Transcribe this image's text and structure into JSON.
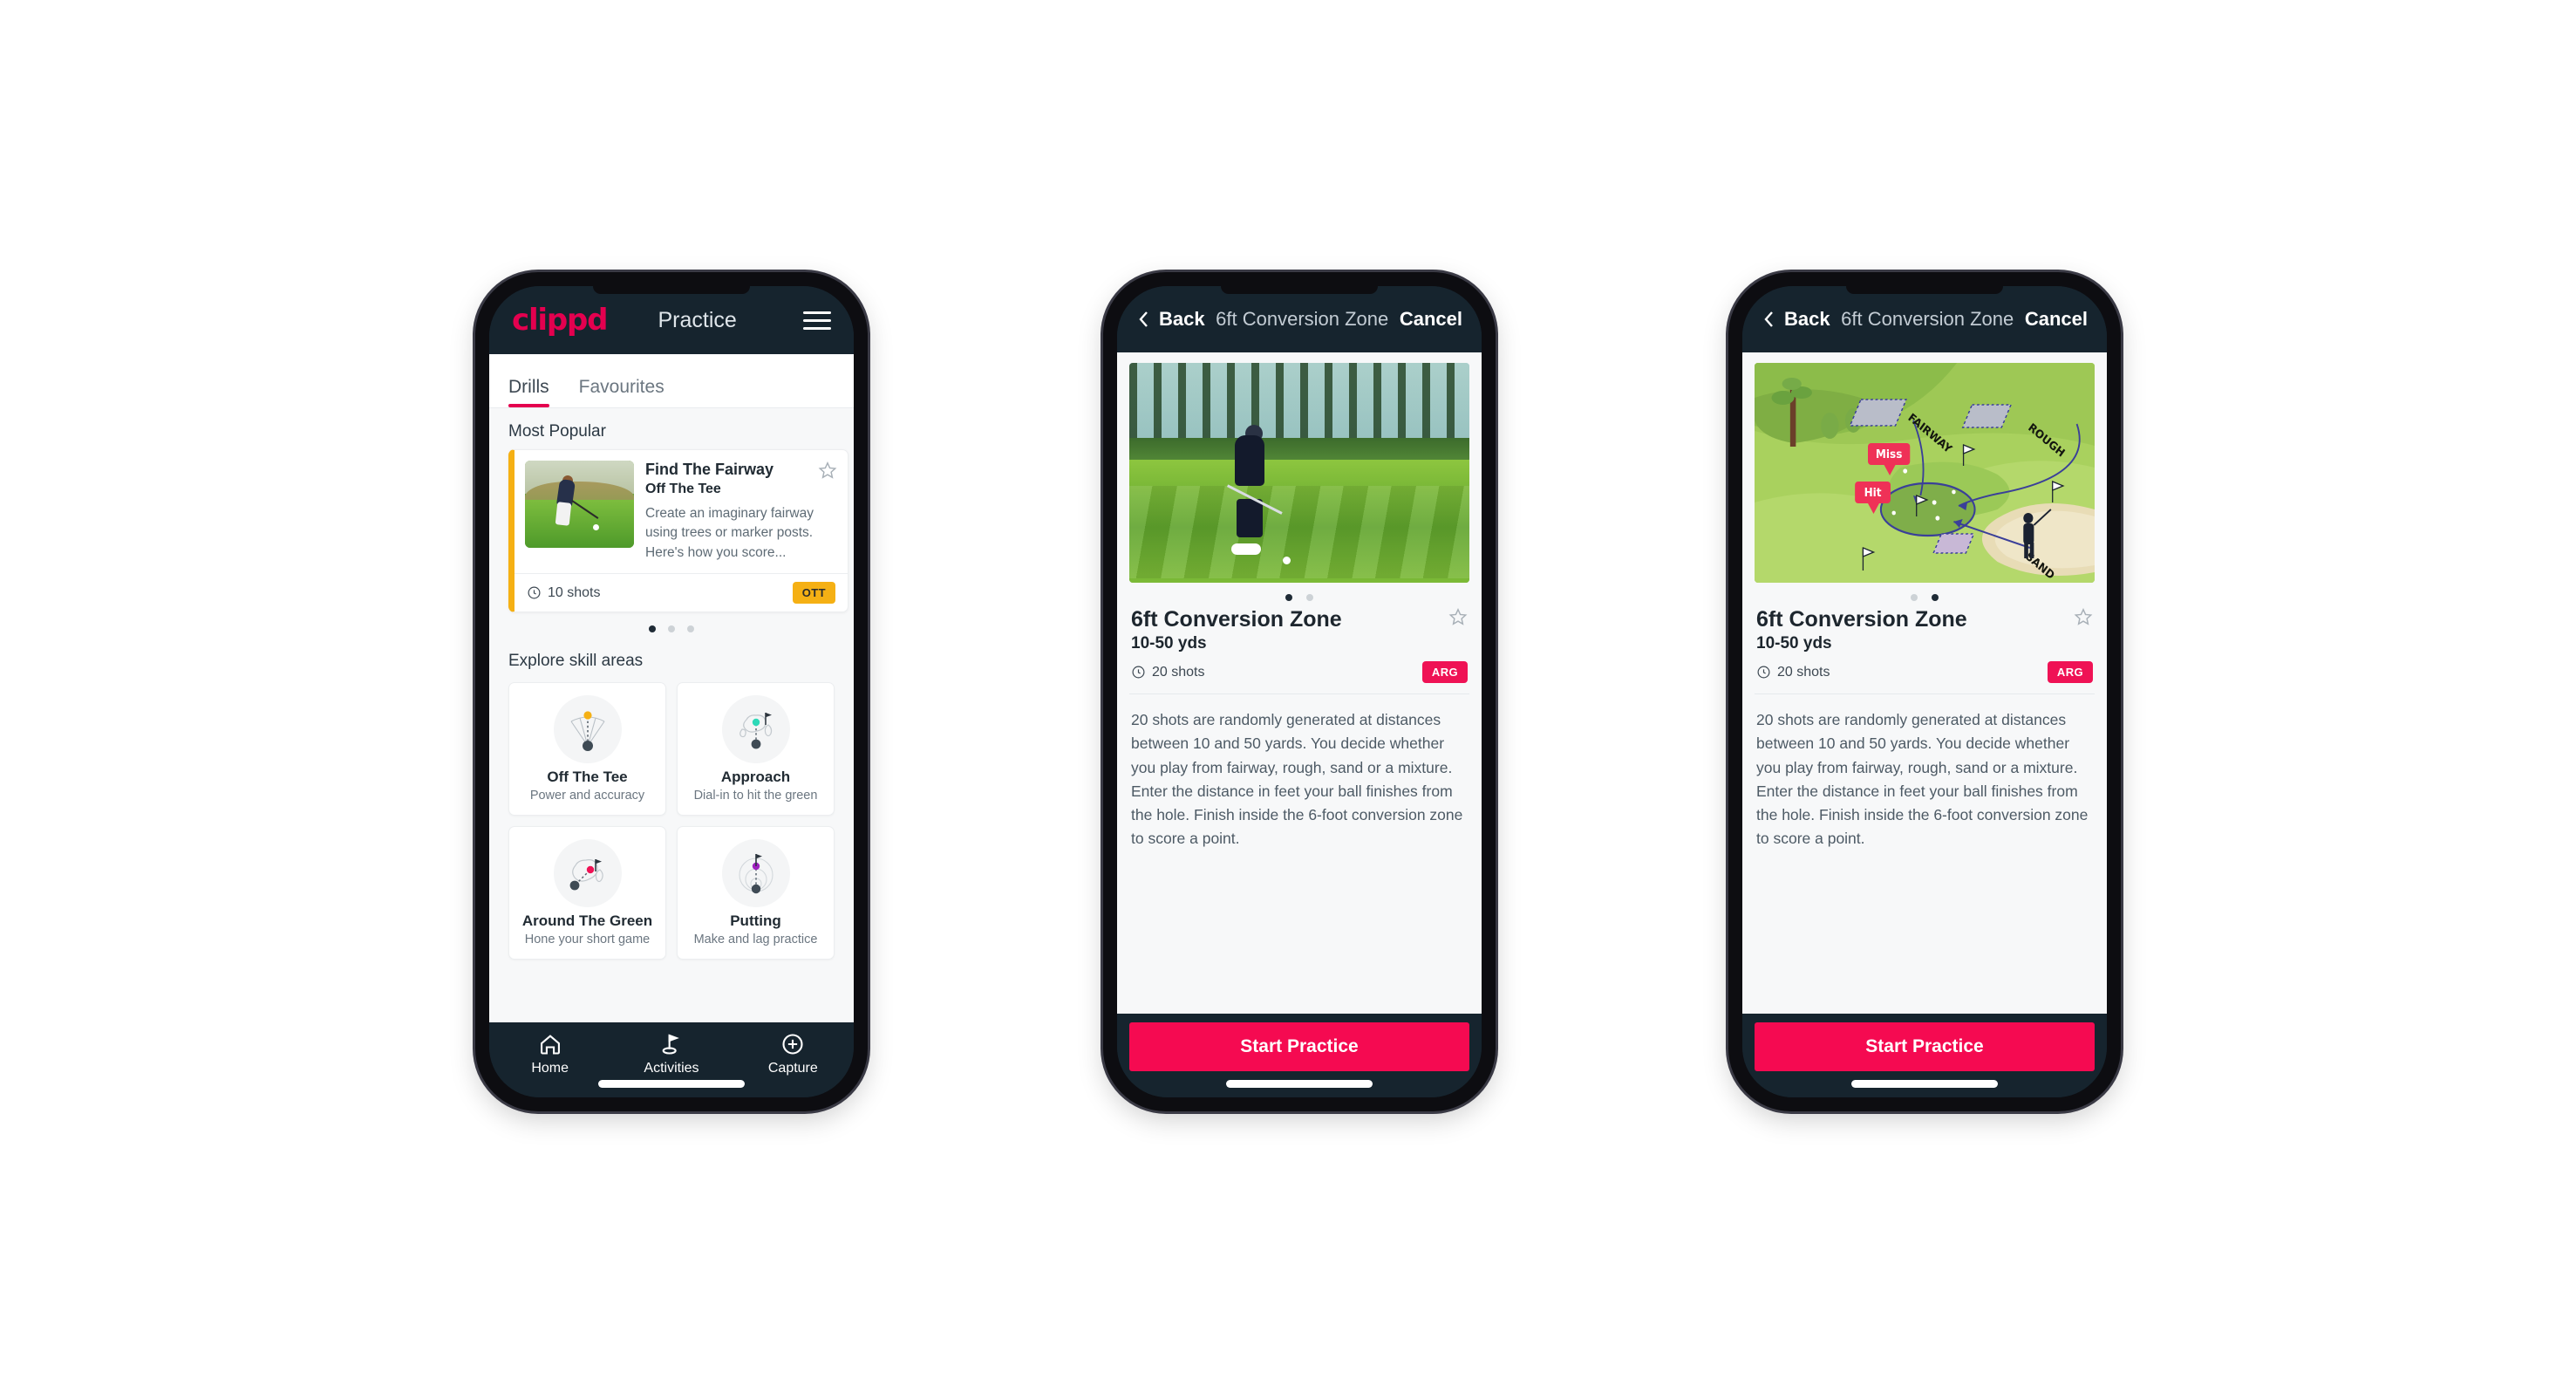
{
  "colors": {
    "brand_pink": "#e4004f",
    "cta_pink": "#f50a51",
    "badge_ott_yellow": "#f5b014",
    "badge_arg_pink": "#ef1255",
    "header_navy": "#16242e",
    "accent_teal": "#2ed9b8"
  },
  "phone1": {
    "header": {
      "logo": "clippd",
      "title": "Practice",
      "menu_icon": "hamburger-menu-icon"
    },
    "tabs": [
      {
        "label": "Drills",
        "active": true
      },
      {
        "label": "Favourites",
        "active": false
      }
    ],
    "most_popular": {
      "section_title": "Most Popular",
      "card": {
        "name": "Find The Fairway",
        "skill": "Off The Tee",
        "description": "Create an imaginary fairway using trees or marker posts. Here's how you score...",
        "shots": "10 shots",
        "badge": "OTT",
        "favourite_icon": "star-outline-icon",
        "shots_icon": "clock-icon",
        "accent_color": "#f5b014"
      },
      "dots": [
        true,
        false,
        false
      ]
    },
    "skill_areas": {
      "section_title": "Explore skill areas",
      "items": [
        {
          "name": "Off The Tee",
          "desc": "Power and accuracy",
          "icon": "tee-fan-icon",
          "dot_color": "#f5b014"
        },
        {
          "name": "Approach",
          "desc": "Dial-in to hit the green",
          "icon": "approach-green-icon",
          "dot_color": "#2ed9b8"
        },
        {
          "name": "Around The Green",
          "desc": "Hone your short game",
          "icon": "around-green-icon",
          "dot_color": "#ef1255"
        },
        {
          "name": "Putting",
          "desc": "Make and lag practice",
          "icon": "putting-rings-icon",
          "dot_color": "#a020c0"
        }
      ]
    },
    "bottom_nav": [
      {
        "label": "Home",
        "icon": "home-icon",
        "active": false
      },
      {
        "label": "Activities",
        "icon": "golf-flag-icon",
        "active": true
      },
      {
        "label": "Capture",
        "icon": "plus-circle-icon",
        "active": false
      }
    ]
  },
  "phone2": {
    "header": {
      "back": "Back",
      "title": "6ft Conversion Zone",
      "cancel": "Cancel",
      "back_icon": "chevron-left-icon"
    },
    "hero": {
      "type": "photo",
      "alt": "golfer-chipping-photo"
    },
    "dots": [
      true,
      false
    ],
    "detail": {
      "name": "6ft Conversion Zone",
      "yards": "10-50 yds",
      "shots": "20 shots",
      "badge": "ARG",
      "favourite_icon": "star-outline-icon",
      "shots_icon": "clock-icon",
      "description": "20 shots are randomly generated at distances between 10 and 50 yards. You decide whether you play from fairway, rough, sand or a mixture. Enter the distance in feet your ball finishes from the hole. Finish inside the 6-foot conversion zone to score a point."
    },
    "cta": "Start Practice"
  },
  "phone3": {
    "header": {
      "back": "Back",
      "title": "6ft Conversion Zone",
      "cancel": "Cancel",
      "back_icon": "chevron-left-icon"
    },
    "hero": {
      "type": "illustration",
      "alt": "golf-hole-diagram",
      "labels": {
        "fairway": "FAIRWAY",
        "rough": "ROUGH",
        "sand": "SAND",
        "miss": "Miss",
        "hit": "Hit"
      }
    },
    "dots": [
      false,
      true
    ],
    "detail": {
      "name": "6ft Conversion Zone",
      "yards": "10-50 yds",
      "shots": "20 shots",
      "badge": "ARG",
      "favourite_icon": "star-outline-icon",
      "shots_icon": "clock-icon",
      "description": "20 shots are randomly generated at distances between 10 and 50 yards. You decide whether you play from fairway, rough, sand or a mixture. Enter the distance in feet your ball finishes from the hole. Finish inside the 6-foot conversion zone to score a point."
    },
    "cta": "Start Practice"
  }
}
